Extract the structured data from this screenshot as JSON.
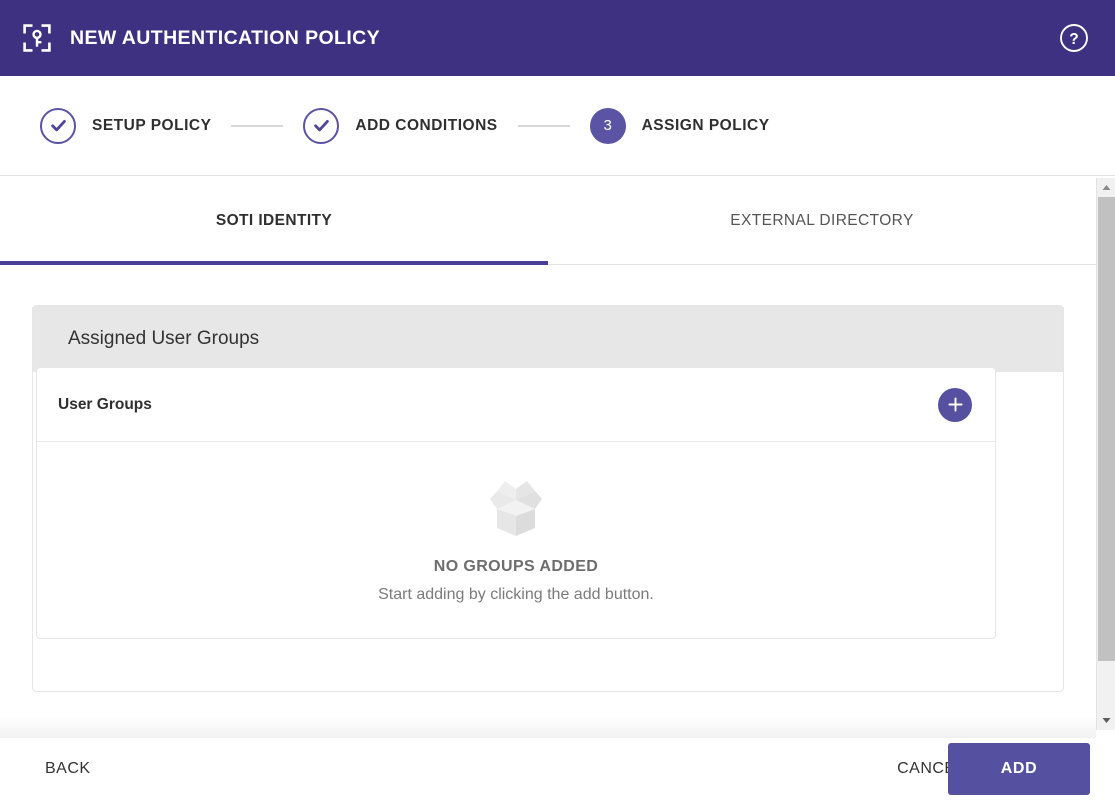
{
  "header": {
    "title": "NEW AUTHENTICATION POLICY",
    "icon": "authentication-policy-icon",
    "help_icon": "help-circle-icon",
    "background_color": "#3F3181"
  },
  "stepper": {
    "steps": [
      {
        "label": "SETUP POLICY",
        "number": "1",
        "state": "done"
      },
      {
        "label": "ADD CONDITIONS",
        "number": "2",
        "state": "done"
      },
      {
        "label": "ASSIGN POLICY",
        "number": "3",
        "state": "active"
      }
    ],
    "active_color": "#5B54A4",
    "connector_color": "#D8D8D8"
  },
  "tabs": {
    "items": [
      {
        "label": "SOTI IDENTITY",
        "active": true
      },
      {
        "label": "EXTERNAL DIRECTORY",
        "active": false
      }
    ],
    "indicator_color": "#4A3F96"
  },
  "panel": {
    "title": "Assigned User Groups",
    "header_background": "#E7E7E7",
    "section": {
      "title": "User Groups",
      "add_button_icon": "plus-icon",
      "add_button_color": "#55509F"
    },
    "empty_state": {
      "illustration": "empty-box-icon",
      "title": "NO GROUPS ADDED",
      "subtitle": "Start adding by clicking the add button."
    }
  },
  "scrollbar": {
    "up_arrow_icon": "scroll-up-arrow-icon",
    "down_arrow_icon": "scroll-down-arrow-icon",
    "thumb_color": "#C1C1C1"
  },
  "footer": {
    "back_label": "BACK",
    "cancel_label": "CANCEL",
    "add_label": "ADD",
    "primary_color": "#55509F"
  }
}
